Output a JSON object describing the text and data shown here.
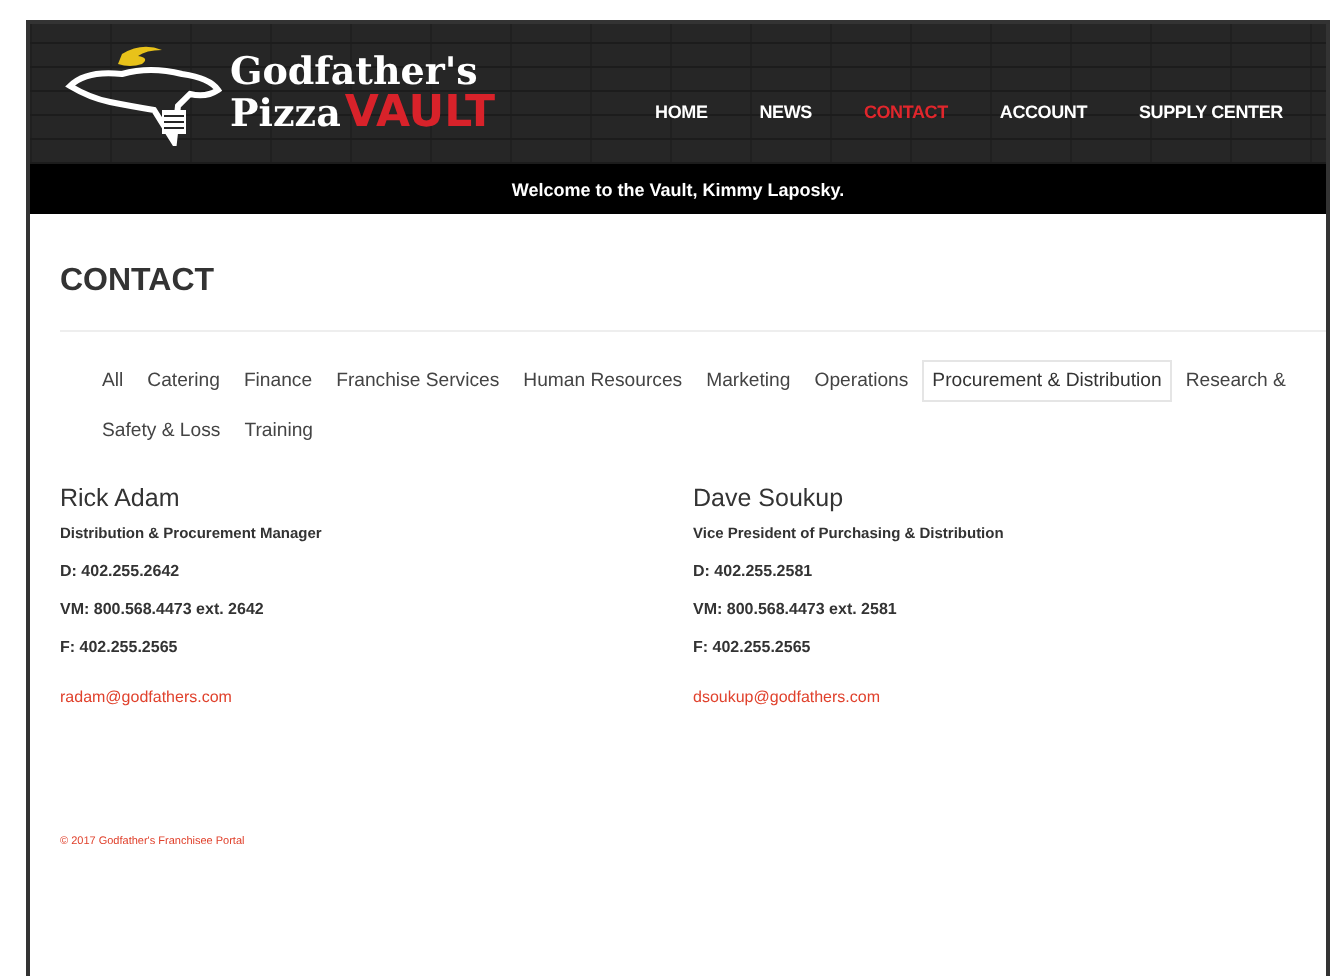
{
  "logo": {
    "line1": "Godfather's",
    "line2": "Pizza",
    "line3": "VAULT"
  },
  "nav": [
    {
      "label": "HOME",
      "selected": false
    },
    {
      "label": "NEWS",
      "selected": false
    },
    {
      "label": "CONTACT",
      "selected": true
    },
    {
      "label": "ACCOUNT",
      "selected": false
    },
    {
      "label": "SUPPLY CENTER",
      "selected": false
    }
  ],
  "welcome": "Welcome to the Vault, Kimmy Laposky.",
  "page_title": "CONTACT",
  "tab_rows": [
    [
      {
        "label": "All",
        "selected": false
      },
      {
        "label": "Catering",
        "selected": false
      },
      {
        "label": "Finance",
        "selected": false
      },
      {
        "label": "Franchise Services",
        "selected": false
      },
      {
        "label": "Human Resources",
        "selected": false
      },
      {
        "label": "Marketing",
        "selected": false
      },
      {
        "label": "Operations",
        "selected": false
      },
      {
        "label": "Procurement & Distribution",
        "selected": true
      },
      {
        "label": "Research &",
        "selected": false
      }
    ],
    [
      {
        "label": "Safety & Loss",
        "selected": false
      },
      {
        "label": "Training",
        "selected": false
      }
    ]
  ],
  "contacts": [
    {
      "name": "Rick Adam",
      "title": "Distribution & Procurement Manager",
      "direct": "D: 402.255.2642",
      "voicemail": "VM: 800.568.4473 ext. 2642",
      "fax": "F: 402.255.2565",
      "email": "radam@godfathers.com"
    },
    {
      "name": "Dave Soukup",
      "title": "Vice President of Purchasing & Distribution",
      "direct": "D: 402.255.2581",
      "voicemail": "VM: 800.568.4473 ext. 2581",
      "fax": "F: 402.255.2565",
      "email": "dsoukup@godfathers.com"
    }
  ],
  "footer": "© 2017 Godfather's Franchisee Portal"
}
